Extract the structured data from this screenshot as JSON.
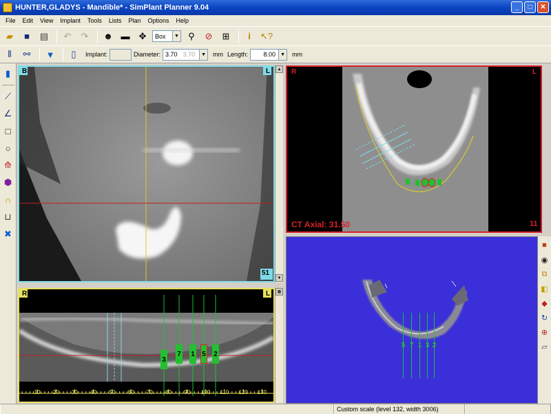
{
  "window": {
    "title": "HUNTER,GLADYS - Mandible* - SimPlant Planner 9.04"
  },
  "menu": [
    "File",
    "Edit",
    "View",
    "Implant",
    "Tools",
    "Lists",
    "Plan",
    "Options",
    "Help"
  ],
  "toolbar": {
    "mode_select": "Box"
  },
  "implant_bar": {
    "implant_label": "Implant:",
    "diameter_label": "Diameter:",
    "diameter_value": "3.70",
    "diameter_secondary": "3.70",
    "diameter_unit": "mm",
    "length_label": "Length:",
    "length_value": "8.00",
    "length_unit": "mm"
  },
  "views": {
    "cross_section": {
      "left": "B",
      "right": "L",
      "slice": "51"
    },
    "axial": {
      "left": "R",
      "right": "L",
      "title": "CT Axial: 31.50",
      "slice": "11"
    },
    "panoramic": {
      "left": "R",
      "right": "L",
      "ruler": [
        "10",
        "20",
        "30",
        "40",
        "50",
        "60",
        "70",
        "80",
        "90",
        "100",
        "110",
        "120",
        "130"
      ],
      "implants": [
        "3",
        "7",
        "1",
        "5",
        "2"
      ]
    },
    "render3d": {
      "implants": [
        "5",
        "7",
        "1",
        "3",
        "2"
      ]
    }
  },
  "colors": {
    "cross_border": "#7fdbe8",
    "axial_border": "#d8202a",
    "pano_border": "#e8e060",
    "render3d_bg": "#3a2fd8",
    "implant_green": "#22c030"
  },
  "status": {
    "scale": "Custom scale (level 132, width 3006)"
  }
}
